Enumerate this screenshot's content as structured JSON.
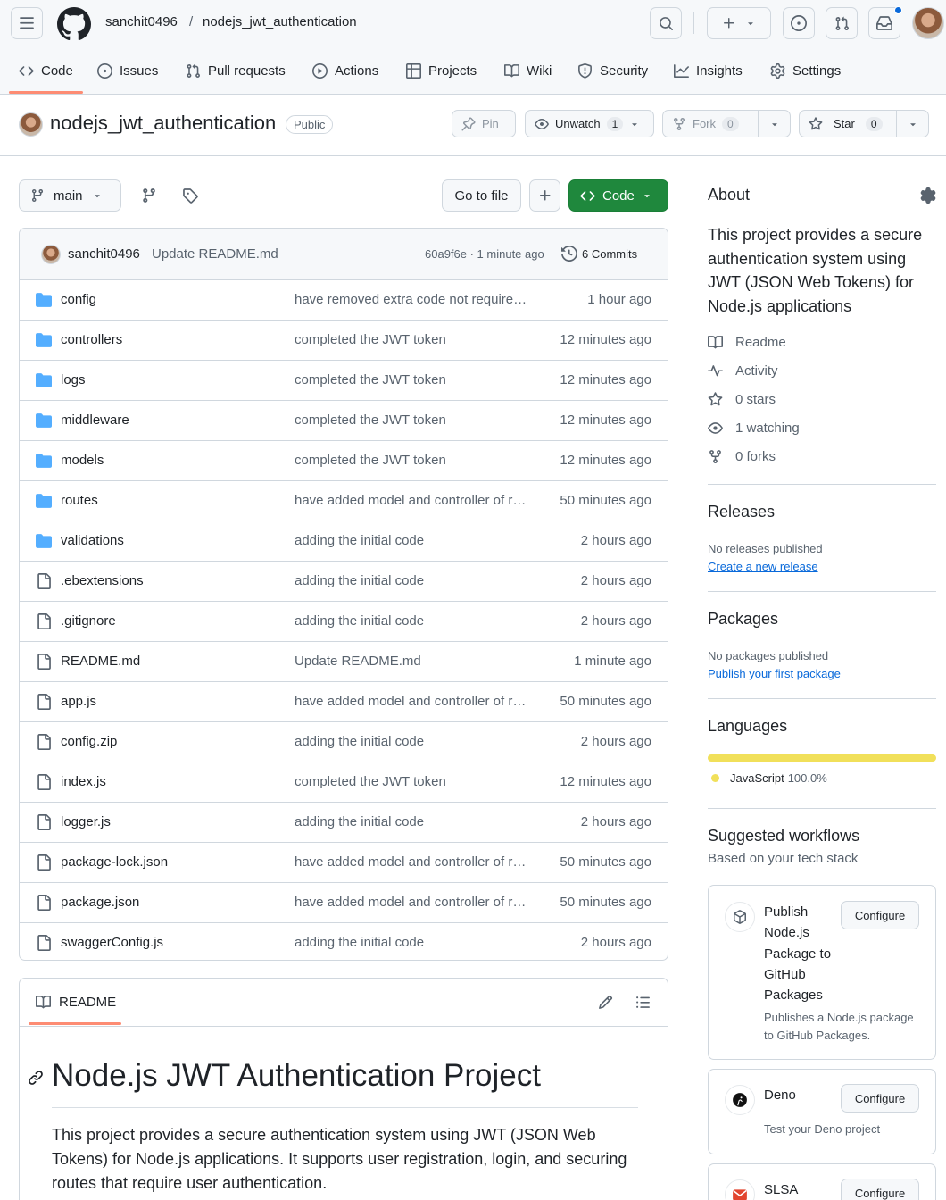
{
  "header": {
    "owner": "sanchit0496",
    "separator": "/",
    "repo": "nodejs_jwt_authentication"
  },
  "nav": {
    "code": "Code",
    "issues": "Issues",
    "pull_requests": "Pull requests",
    "actions": "Actions",
    "projects": "Projects",
    "wiki": "Wiki",
    "security": "Security",
    "insights": "Insights",
    "settings": "Settings"
  },
  "repo_bar": {
    "title": "nodejs_jwt_authentication",
    "visibility": "Public",
    "pin": "Pin",
    "unwatch": "Unwatch",
    "watch_count": "1",
    "fork": "Fork",
    "fork_count": "0",
    "star": "Star",
    "star_count": "0"
  },
  "toolbar": {
    "branch": "main",
    "go_to_file": "Go to file",
    "code": "Code"
  },
  "commit": {
    "author": "sanchit0496",
    "message": "Update README.md",
    "hash_time": "60a9f6e · 1 minute ago",
    "commits": "6 Commits"
  },
  "files": [
    {
      "name": "config",
      "type": "dir",
      "msg": "have removed extra code not require…",
      "age": "1 hour ago"
    },
    {
      "name": "controllers",
      "type": "dir",
      "msg": "completed the JWT token",
      "age": "12 minutes ago"
    },
    {
      "name": "logs",
      "type": "dir",
      "msg": "completed the JWT token",
      "age": "12 minutes ago"
    },
    {
      "name": "middleware",
      "type": "dir",
      "msg": "completed the JWT token",
      "age": "12 minutes ago"
    },
    {
      "name": "models",
      "type": "dir",
      "msg": "completed the JWT token",
      "age": "12 minutes ago"
    },
    {
      "name": "routes",
      "type": "dir",
      "msg": "have added model and controller of r…",
      "age": "50 minutes ago"
    },
    {
      "name": "validations",
      "type": "dir",
      "msg": "adding the initial code",
      "age": "2 hours ago"
    },
    {
      "name": ".ebextensions",
      "type": "file",
      "msg": "adding the initial code",
      "age": "2 hours ago"
    },
    {
      "name": ".gitignore",
      "type": "file",
      "msg": "adding the initial code",
      "age": "2 hours ago"
    },
    {
      "name": "README.md",
      "type": "file",
      "msg": "Update README.md",
      "age": "1 minute ago"
    },
    {
      "name": "app.js",
      "type": "file",
      "msg": "have added model and controller of r…",
      "age": "50 minutes ago"
    },
    {
      "name": "config.zip",
      "type": "file",
      "msg": "adding the initial code",
      "age": "2 hours ago"
    },
    {
      "name": "index.js",
      "type": "file",
      "msg": "completed the JWT token",
      "age": "12 minutes ago"
    },
    {
      "name": "logger.js",
      "type": "file",
      "msg": "adding the initial code",
      "age": "2 hours ago"
    },
    {
      "name": "package-lock.json",
      "type": "file",
      "msg": "have added model and controller of r…",
      "age": "50 minutes ago"
    },
    {
      "name": "package.json",
      "type": "file",
      "msg": "have added model and controller of r…",
      "age": "50 minutes ago"
    },
    {
      "name": "swaggerConfig.js",
      "type": "file",
      "msg": "adding the initial code",
      "age": "2 hours ago"
    }
  ],
  "readme": {
    "tab": "README",
    "heading": "Node.js JWT Authentication Project",
    "body": "This project provides a secure authentication system using JWT (JSON Web Tokens) for Node.js applications. It supports user registration, login, and securing routes that require user authentication."
  },
  "about": {
    "title": "About",
    "description": "This project provides a secure authentication system using JWT (JSON Web Tokens) for Node.js applications",
    "readme": "Readme",
    "activity": "Activity",
    "stars": "0 stars",
    "watching": "1 watching",
    "forks": "0 forks"
  },
  "releases": {
    "title": "Releases",
    "empty": "No releases published",
    "link": "Create a new release"
  },
  "packages": {
    "title": "Packages",
    "empty": "No packages published",
    "link": "Publish your first package"
  },
  "languages": {
    "title": "Languages",
    "name": "JavaScript",
    "percent": "100.0%",
    "share": 1.0,
    "color": "#f1e05a"
  },
  "workflows": {
    "title": "Suggested workflows",
    "subtitle": "Based on your tech stack",
    "items": [
      {
        "name": "Publish Node.js Package to GitHub Packages",
        "desc": "Publishes a Node.js package to GitHub Packages.",
        "button": "Configure"
      },
      {
        "name": "Deno",
        "desc": "Test your Deno project",
        "button": "Configure"
      },
      {
        "name": "SLSA",
        "desc": "",
        "button": "Configure"
      }
    ]
  },
  "colors": {
    "green": "#1f883d",
    "accent": "#fd8c73",
    "link": "#0969da",
    "folder": "#54aeff"
  }
}
